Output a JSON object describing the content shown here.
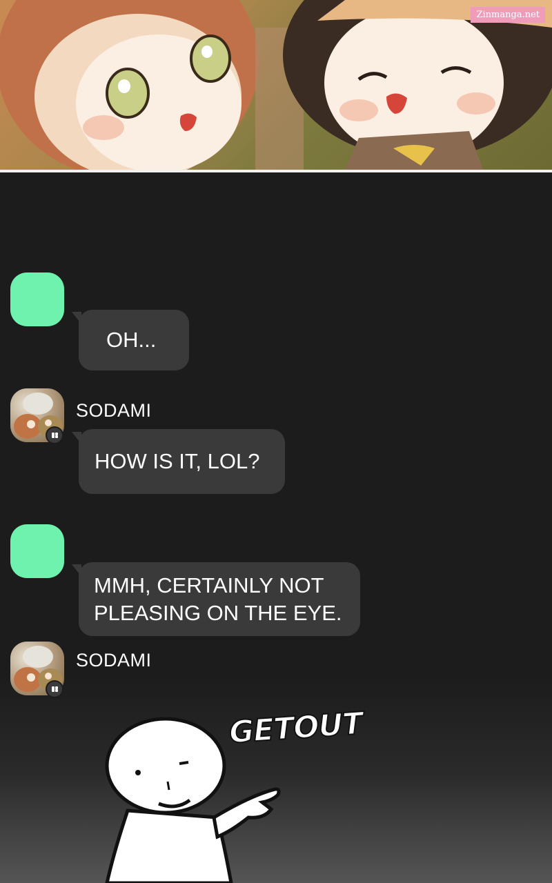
{
  "watermark": "Zinmanga.net",
  "messages": [
    {
      "sender": "",
      "text": "OH..."
    },
    {
      "sender": "SODAMI",
      "text": "HOW IS IT, LOL?"
    },
    {
      "sender": "",
      "text": "MMH, CERTAINLY NOT\nPLEASING ON THE EYE."
    },
    {
      "sender": "SODAMI",
      "text": ""
    }
  ],
  "drawing": {
    "caption": "GETOUT"
  },
  "colors": {
    "background": "#1c1c1c",
    "bubble": "#3a3a3a",
    "user_avatar": "#6ef2ad",
    "text": "#ffffff"
  }
}
